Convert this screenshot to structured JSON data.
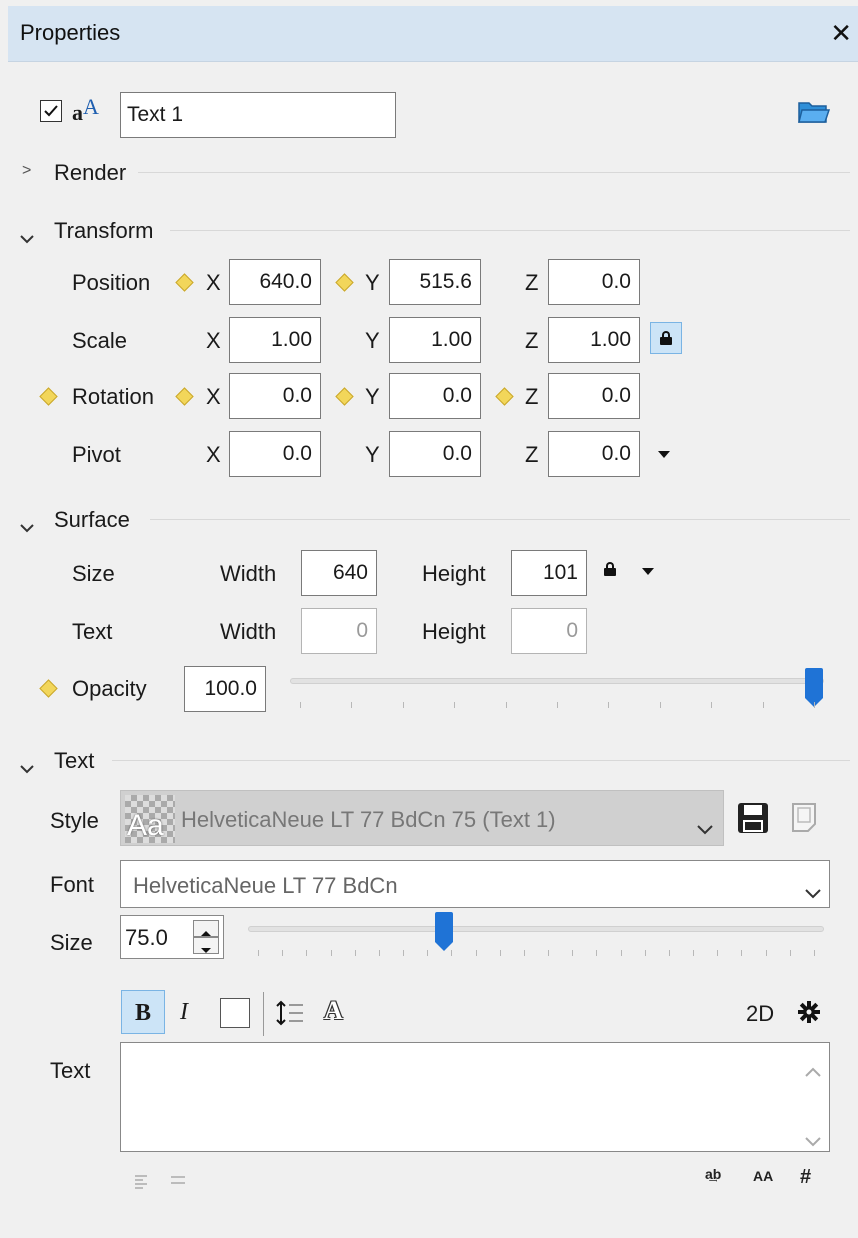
{
  "window": {
    "title": "Properties",
    "close": "✕"
  },
  "header": {
    "visible_checkbox": "☑",
    "name_value": "Text 1"
  },
  "sections": {
    "render": "Render",
    "transform": "Transform",
    "surface": "Surface",
    "text": "Text"
  },
  "transform": {
    "position": {
      "label": "Position",
      "x": "640.0",
      "y": "515.6",
      "z": "0.0"
    },
    "scale": {
      "label": "Scale",
      "x": "1.00",
      "y": "1.00",
      "z": "1.00"
    },
    "rotation": {
      "label": "Rotation",
      "x": "0.0",
      "y": "0.0",
      "z": "0.0"
    },
    "pivot": {
      "label": "Pivot",
      "x": "0.0",
      "y": "0.0",
      "z": "0.0"
    },
    "axis": {
      "x": "X",
      "y": "Y",
      "z": "Z"
    }
  },
  "surface": {
    "size": {
      "label": "Size",
      "width_label": "Width",
      "width": "640",
      "height_label": "Height",
      "height": "101"
    },
    "text": {
      "label": "Text",
      "width_label": "Width",
      "width": "0",
      "height_label": "Height",
      "height": "0"
    },
    "opacity": {
      "label": "Opacity",
      "value": "100.0",
      "level": 1.0
    }
  },
  "text_section": {
    "style_label": "Style",
    "style_value": "HelveticaNeue LT 77 BdCn 75 (Text 1)",
    "style_preview": "Aa",
    "font_label": "Font",
    "font_value": "HelveticaNeue LT 77 BdCn",
    "size_label": "Size",
    "size_value": "75.0",
    "size_level": 0.335,
    "toolbar": {
      "bold": "B",
      "italic": "I",
      "mode": "2D"
    },
    "text_label": "Text",
    "text_value": ""
  },
  "colors": {
    "accent": "#1f73d6",
    "keyframe": "#f2d65a",
    "titlebar": "#d6e4f2"
  }
}
